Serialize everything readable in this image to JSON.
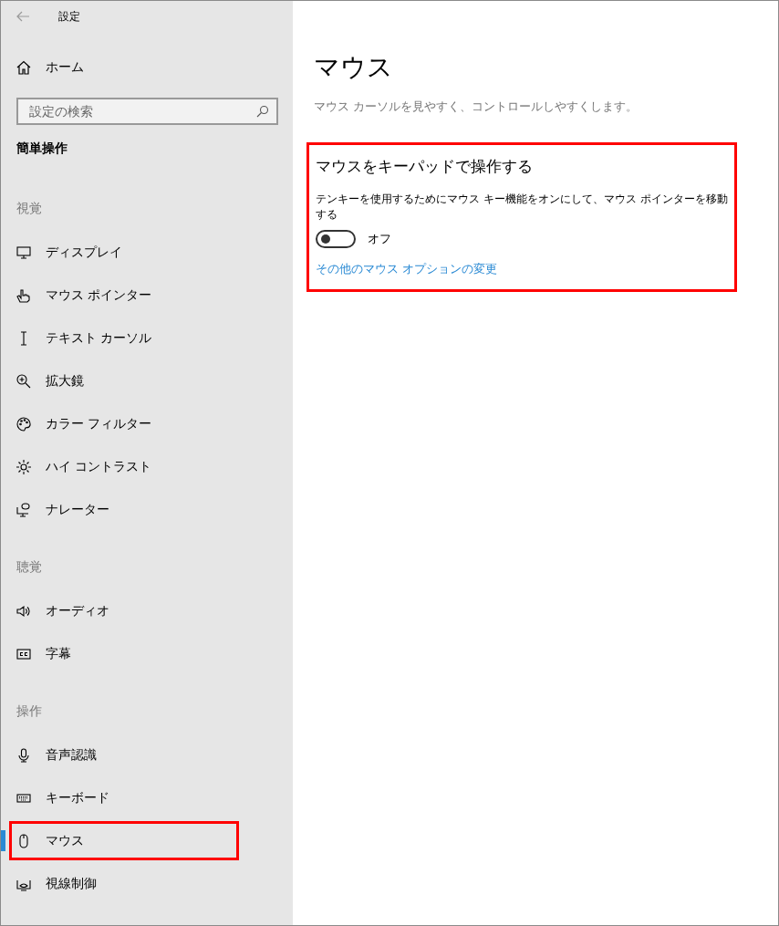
{
  "window": {
    "title": "設定"
  },
  "sidebar": {
    "home": "ホーム",
    "search": {
      "placeholder": "設定の検索"
    },
    "category": "簡単操作",
    "groups": [
      {
        "heading": "視覚",
        "items": [
          {
            "kind": "display",
            "label": "ディスプレイ",
            "selected": false,
            "highlighted": false
          },
          {
            "kind": "pointer",
            "label": "マウス ポインター",
            "selected": false,
            "highlighted": false
          },
          {
            "kind": "cursor",
            "label": "テキスト カーソル",
            "selected": false,
            "highlighted": false
          },
          {
            "kind": "magnifier",
            "label": "拡大鏡",
            "selected": false,
            "highlighted": false
          },
          {
            "kind": "palette",
            "label": "カラー フィルター",
            "selected": false,
            "highlighted": false
          },
          {
            "kind": "sun",
            "label": "ハイ コントラスト",
            "selected": false,
            "highlighted": false
          },
          {
            "kind": "narrator",
            "label": "ナレーター",
            "selected": false,
            "highlighted": false
          }
        ]
      },
      {
        "heading": "聴覚",
        "items": [
          {
            "kind": "speaker",
            "label": "オーディオ",
            "selected": false,
            "highlighted": false
          },
          {
            "kind": "captions",
            "label": "字幕",
            "selected": false,
            "highlighted": false
          }
        ]
      },
      {
        "heading": "操作",
        "items": [
          {
            "kind": "microphone",
            "label": "音声認識",
            "selected": false,
            "highlighted": false
          },
          {
            "kind": "keyboard",
            "label": "キーボード",
            "selected": false,
            "highlighted": false
          },
          {
            "kind": "mouse",
            "label": "マウス",
            "selected": true,
            "highlighted": true
          },
          {
            "kind": "eye",
            "label": "視線制御",
            "selected": false,
            "highlighted": false
          }
        ]
      }
    ]
  },
  "main": {
    "title": "マウス",
    "description": "マウス カーソルを見やすく、コントロールしやすくします。",
    "card": {
      "highlighted": true,
      "heading": "マウスをキーパッドで操作する",
      "description": "テンキーを使用するためにマウス キー機能をオンにして、マウス ポインターを移動する",
      "toggle": {
        "on": false,
        "state_label": "オフ"
      },
      "link": "その他のマウス オプションの変更"
    }
  }
}
